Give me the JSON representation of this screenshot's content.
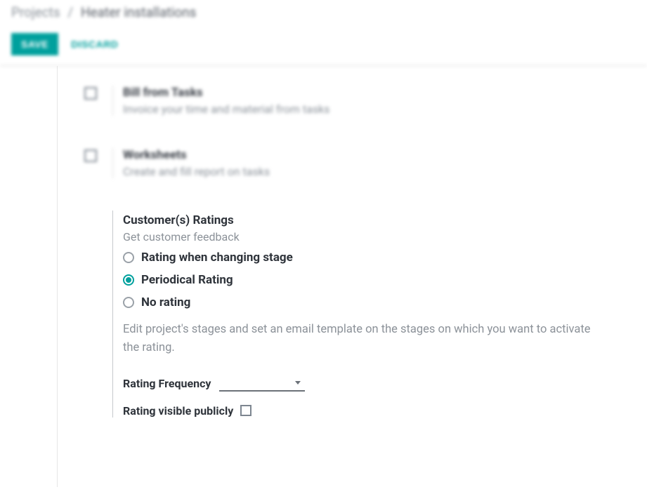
{
  "breadcrumb": {
    "parent": "Projects",
    "current": "Heater installations"
  },
  "buttons": {
    "save": "SAVE",
    "discard": "DISCARD"
  },
  "settings": {
    "bill": {
      "title": "Bill from Tasks",
      "desc": "Invoice your time and material from tasks"
    },
    "worksheets": {
      "title": "Worksheets",
      "desc": "Create and fill report on tasks"
    }
  },
  "ratings": {
    "title": "Customer(s) Ratings",
    "subtitle": "Get customer feedback",
    "options": {
      "stage": "Rating when changing stage",
      "periodical": "Periodical Rating",
      "none": "No rating"
    },
    "help": "Edit project's stages and set an email template on the stages on which you want to activate the rating.",
    "frequency_label": "Rating Frequency",
    "frequency_value": "",
    "public_label": "Rating visible publicly"
  }
}
